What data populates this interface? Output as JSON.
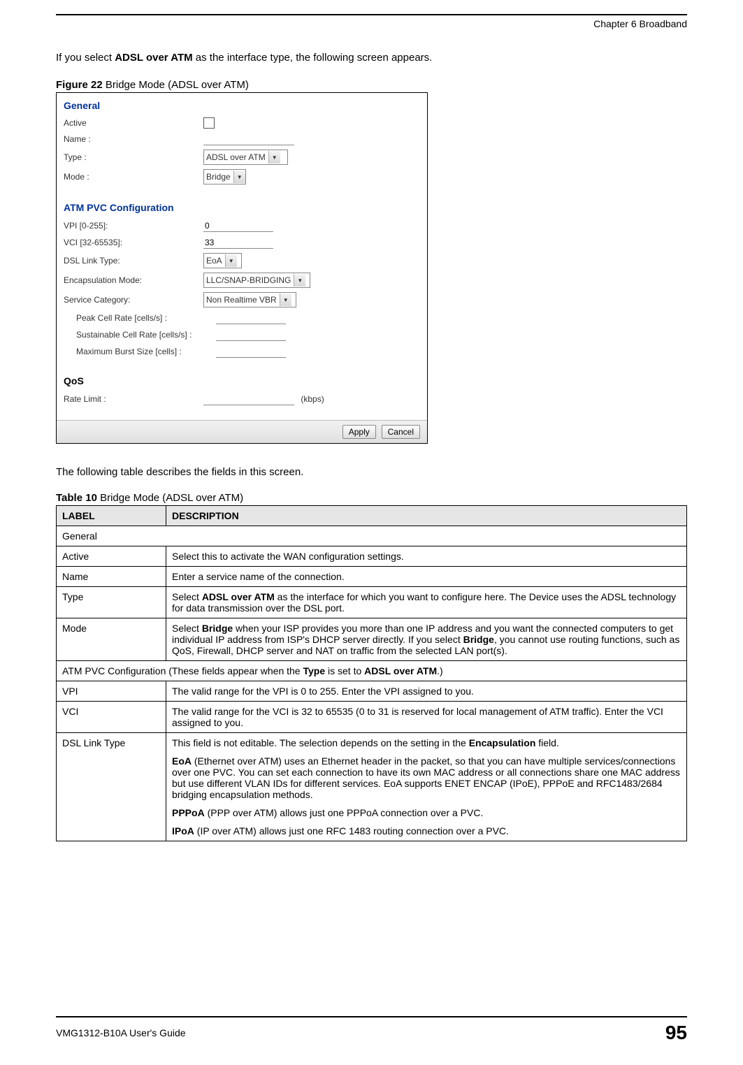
{
  "header": {
    "chapter": "Chapter 6 Broadband"
  },
  "intro": {
    "text_before": "If you select ",
    "bold1": "ADSL over ATM",
    "text_after": " as the interface type, the following screen appears."
  },
  "figure": {
    "label": "Figure 22",
    "title": "   Bridge Mode (ADSL over ATM)"
  },
  "general": {
    "heading": "General",
    "active_label": "Active",
    "name_label": "Name :",
    "name_value": "",
    "type_label": "Type :",
    "type_value": "ADSL over ATM",
    "mode_label": "Mode :",
    "mode_value": "Bridge"
  },
  "atm": {
    "heading": "ATM PVC Configuration",
    "vpi_label": "VPI [0-255]:",
    "vpi_value": "0",
    "vci_label": "VCI [32-65535]:",
    "vci_value": "33",
    "dsl_label": "DSL Link Type:",
    "dsl_value": "EoA",
    "encap_label": "Encapsulation Mode:",
    "encap_value": "LLC/SNAP-BRIDGING",
    "svc_label": "Service Category:",
    "svc_value": "Non Realtime VBR",
    "pcr_label": "Peak Cell Rate [cells/s] :",
    "scr_label": "Sustainable Cell Rate [cells/s] :",
    "mbs_label": "Maximum Burst Size [cells] :"
  },
  "qos": {
    "heading": "QoS",
    "rate_label": "Rate Limit :",
    "rate_unit": "(kbps)"
  },
  "buttons": {
    "apply": "Apply",
    "cancel": "Cancel"
  },
  "mid_text": "The following table describes the fields in this screen.",
  "table": {
    "caption_label": "Table 10",
    "caption_title": "   Bridge Mode (ADSL over ATM)",
    "head_label": "LABEL",
    "head_desc": "DESCRIPTION",
    "rows": {
      "general": {
        "label": "General",
        "desc": ""
      },
      "active": {
        "label": "Active",
        "desc": "Select this to activate the WAN configuration settings."
      },
      "name": {
        "label": "Name",
        "desc": "Enter a service name of the connection."
      },
      "type": {
        "label": "Type",
        "pre": "Select ",
        "bold": "ADSL over ATM",
        "post": " as the interface for which you want to configure here. The Device uses the ADSL technology for data transmission over the DSL port."
      },
      "mode": {
        "label": "Mode",
        "pre": "Select ",
        "bold1": "Bridge",
        "mid": " when your ISP provides you more than one IP address and you want the connected computers to get individual IP address from ISP's DHCP server directly. If you select ",
        "bold2": "Bridge",
        "post": ", you cannot use routing functions, such as QoS, Firewall, DHCP server and NAT on traffic from the selected LAN port(s)."
      },
      "atmhdr": {
        "pre": "ATM PVC Configuration (These fields appear when the ",
        "bold1": "Type",
        "mid": " is set to ",
        "bold2": "ADSL over ATM",
        "post": ".)"
      },
      "vpi": {
        "label": "VPI",
        "desc": "The valid range for the VPI is 0 to 255. Enter the VPI assigned to you."
      },
      "vci": {
        "label": "VCI",
        "desc": "The valid range for the VCI is 32 to 65535 (0 to 31 is reserved for local management of ATM traffic). Enter the VCI assigned to you."
      },
      "dsl": {
        "label": "DSL Link Type",
        "p1pre": "This field is not editable. The selection depends on the setting in the ",
        "p1bold": "Encapsulation",
        "p1post": " field.",
        "p2bold": "EoA",
        "p2post": " (Ethernet over ATM) uses an Ethernet header in the packet, so that you can have multiple services/connections over one PVC. You can set each connection to have its own MAC address or all connections share one MAC address but use different VLAN IDs for different services. EoA supports ENET ENCAP (IPoE), PPPoE and RFC1483/2684 bridging encapsulation methods.",
        "p3bold": "PPPoA",
        "p3post": " (PPP over ATM) allows just one PPPoA connection over a PVC.",
        "p4bold": "IPoA",
        "p4post": " (IP over ATM) allows just one RFC 1483 routing connection over a PVC."
      }
    }
  },
  "footer": {
    "left": "VMG1312-B10A User's Guide",
    "right": "95"
  }
}
